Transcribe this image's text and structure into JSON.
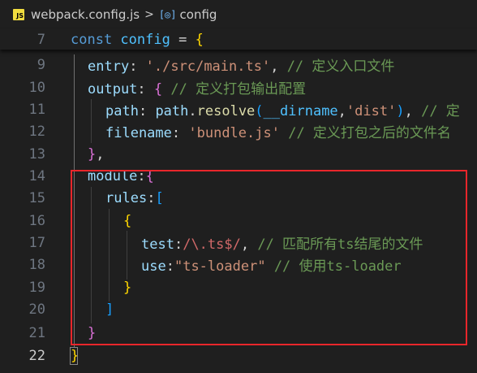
{
  "breadcrumb": {
    "file_icon": "JS",
    "file_name": "webpack.config.js",
    "separator": ">",
    "symbol_icon": "[◎]",
    "symbol_name": "config"
  },
  "lines": [
    {
      "number": "7",
      "tokens": [
        [
          "kw",
          "const "
        ],
        [
          "var",
          "config"
        ],
        [
          "pl",
          " = "
        ],
        [
          "b1",
          "{"
        ]
      ]
    },
    {
      "number": "9",
      "tokens": [
        [
          "prop",
          "entry"
        ],
        [
          "pl",
          ": "
        ],
        [
          "str",
          "'./src/main.ts'"
        ],
        [
          "pl",
          ", "
        ],
        [
          "cm",
          "// 定义入口文件"
        ]
      ]
    },
    {
      "number": "10",
      "tokens": [
        [
          "prop",
          "output"
        ],
        [
          "pl",
          ": "
        ],
        [
          "b2",
          "{"
        ],
        [
          "pl",
          " "
        ],
        [
          "cm",
          "// 定义打包输出配置"
        ]
      ]
    },
    {
      "number": "11",
      "tokens": [
        [
          "prop",
          "path"
        ],
        [
          "pl",
          ": "
        ],
        [
          "prop",
          "path"
        ],
        [
          "pl",
          "."
        ],
        [
          "fn",
          "resolve"
        ],
        [
          "b3",
          "("
        ],
        [
          "var",
          "__dirname"
        ],
        [
          "pl",
          ","
        ],
        [
          "str",
          "'dist'"
        ],
        [
          "b3",
          ")"
        ],
        [
          "pl",
          ", "
        ],
        [
          "cm",
          "// 定"
        ]
      ]
    },
    {
      "number": "12",
      "tokens": [
        [
          "prop",
          "filename"
        ],
        [
          "pl",
          ": "
        ],
        [
          "str",
          "'bundle.js'"
        ],
        [
          "pl",
          " "
        ],
        [
          "cm",
          "// 定义打包之后的文件名"
        ]
      ]
    },
    {
      "number": "13",
      "tokens": [
        [
          "b2",
          "}"
        ],
        [
          "pl",
          ","
        ]
      ]
    },
    {
      "number": "14",
      "tokens": [
        [
          "prop",
          "module"
        ],
        [
          "pl",
          ":"
        ],
        [
          "b2",
          "{"
        ]
      ]
    },
    {
      "number": "15",
      "tokens": [
        [
          "prop",
          "rules"
        ],
        [
          "pl",
          ":"
        ],
        [
          "b3",
          "["
        ]
      ]
    },
    {
      "number": "16",
      "tokens": [
        [
          "b1",
          "{"
        ]
      ]
    },
    {
      "number": "17",
      "tokens": [
        [
          "prop",
          "test"
        ],
        [
          "pl",
          ":"
        ],
        [
          "re",
          "/\\.ts$/"
        ],
        [
          "pl",
          ", "
        ],
        [
          "cm",
          "// 匹配所有ts结尾的文件"
        ]
      ]
    },
    {
      "number": "18",
      "tokens": [
        [
          "prop",
          "use"
        ],
        [
          "pl",
          ":"
        ],
        [
          "str",
          "\"ts-loader\""
        ],
        [
          "pl",
          " "
        ],
        [
          "cm",
          "// 使用ts-loader"
        ]
      ]
    },
    {
      "number": "19",
      "tokens": [
        [
          "b1",
          "}"
        ]
      ]
    },
    {
      "number": "20",
      "tokens": [
        [
          "b3",
          "]"
        ]
      ]
    },
    {
      "number": "21",
      "tokens": [
        [
          "b2",
          "}"
        ]
      ]
    },
    {
      "number": "22",
      "tokens": [
        [
          "b1",
          "}"
        ]
      ]
    }
  ]
}
